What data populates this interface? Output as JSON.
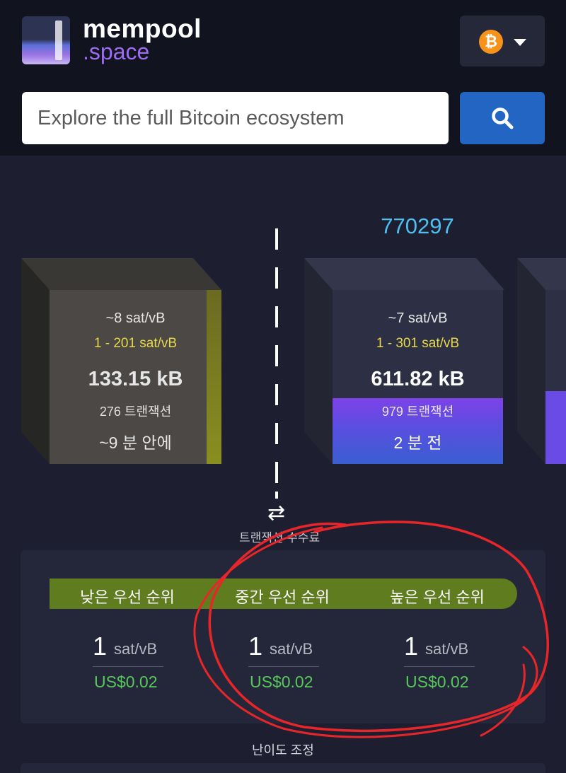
{
  "header": {
    "brand_line1": "mempool",
    "brand_line2": ".space",
    "network_icon_glyph": "₿",
    "network_icon": "bitcoin-icon"
  },
  "search": {
    "placeholder": "Explore the full Bitcoin ecosystem",
    "button_icon": "search-icon"
  },
  "mempool_block": {
    "median_fee": "~8 sat/vB",
    "fee_range": "1 - 201 sat/vB",
    "size": "133.15 kB",
    "tx_count": "276 트랜잭션",
    "eta": "~9 분 안에"
  },
  "mined_block": {
    "height": "770297",
    "median_fee": "~7 sat/vB",
    "fee_range": "1 - 301 sat/vB",
    "size": "611.82 kB",
    "tx_count": "979 트랜잭션",
    "time_ago": "2 분 전"
  },
  "divider": {
    "icon": "arrows-exchange-icon",
    "icon_glyph": "⇄",
    "label": "트랜잭션 수수료"
  },
  "fees": {
    "priorities": [
      {
        "label": "낮은 우선 순위",
        "value": "1",
        "unit": "sat/vB",
        "usd": "US$0.02"
      },
      {
        "label": "중간 우선 순위",
        "value": "1",
        "unit": "sat/vB",
        "usd": "US$0.02"
      },
      {
        "label": "높은 우선 순위",
        "value": "1",
        "unit": "sat/vB",
        "usd": "US$0.02"
      }
    ]
  },
  "difficulty": {
    "label": "난이도 조정"
  },
  "colors": {
    "background": "#1d1f31",
    "header": "#11131f",
    "accent_blue": "#2365c2",
    "fee_range_yellow": "#e8d84a",
    "usd_green": "#57c85a",
    "priority_bar": "#5f7d1f",
    "annotation_red": "#e8262a"
  }
}
